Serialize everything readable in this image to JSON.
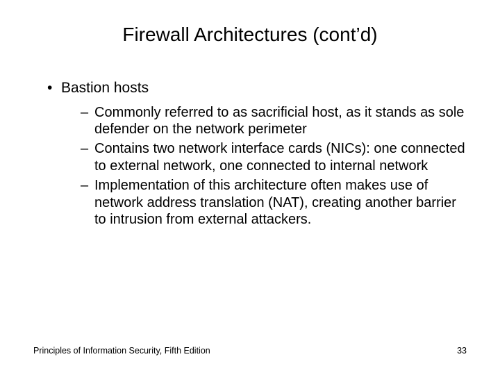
{
  "title": "Firewall Architectures (cont’d)",
  "bullets": {
    "lvl1_0": "Bastion hosts",
    "lvl2_0": "Commonly referred to as sacrificial host, as it stands as sole defender on the network perimeter",
    "lvl2_1": "Contains two network interface cards (NICs): one connected to external network, one connected to internal network",
    "lvl2_2": "Implementation of this architecture often makes use of network address translation (NAT), creating another barrier to intrusion from external attackers."
  },
  "footer": {
    "source": "Principles of Information Security, Fifth Edition",
    "page": "33"
  }
}
